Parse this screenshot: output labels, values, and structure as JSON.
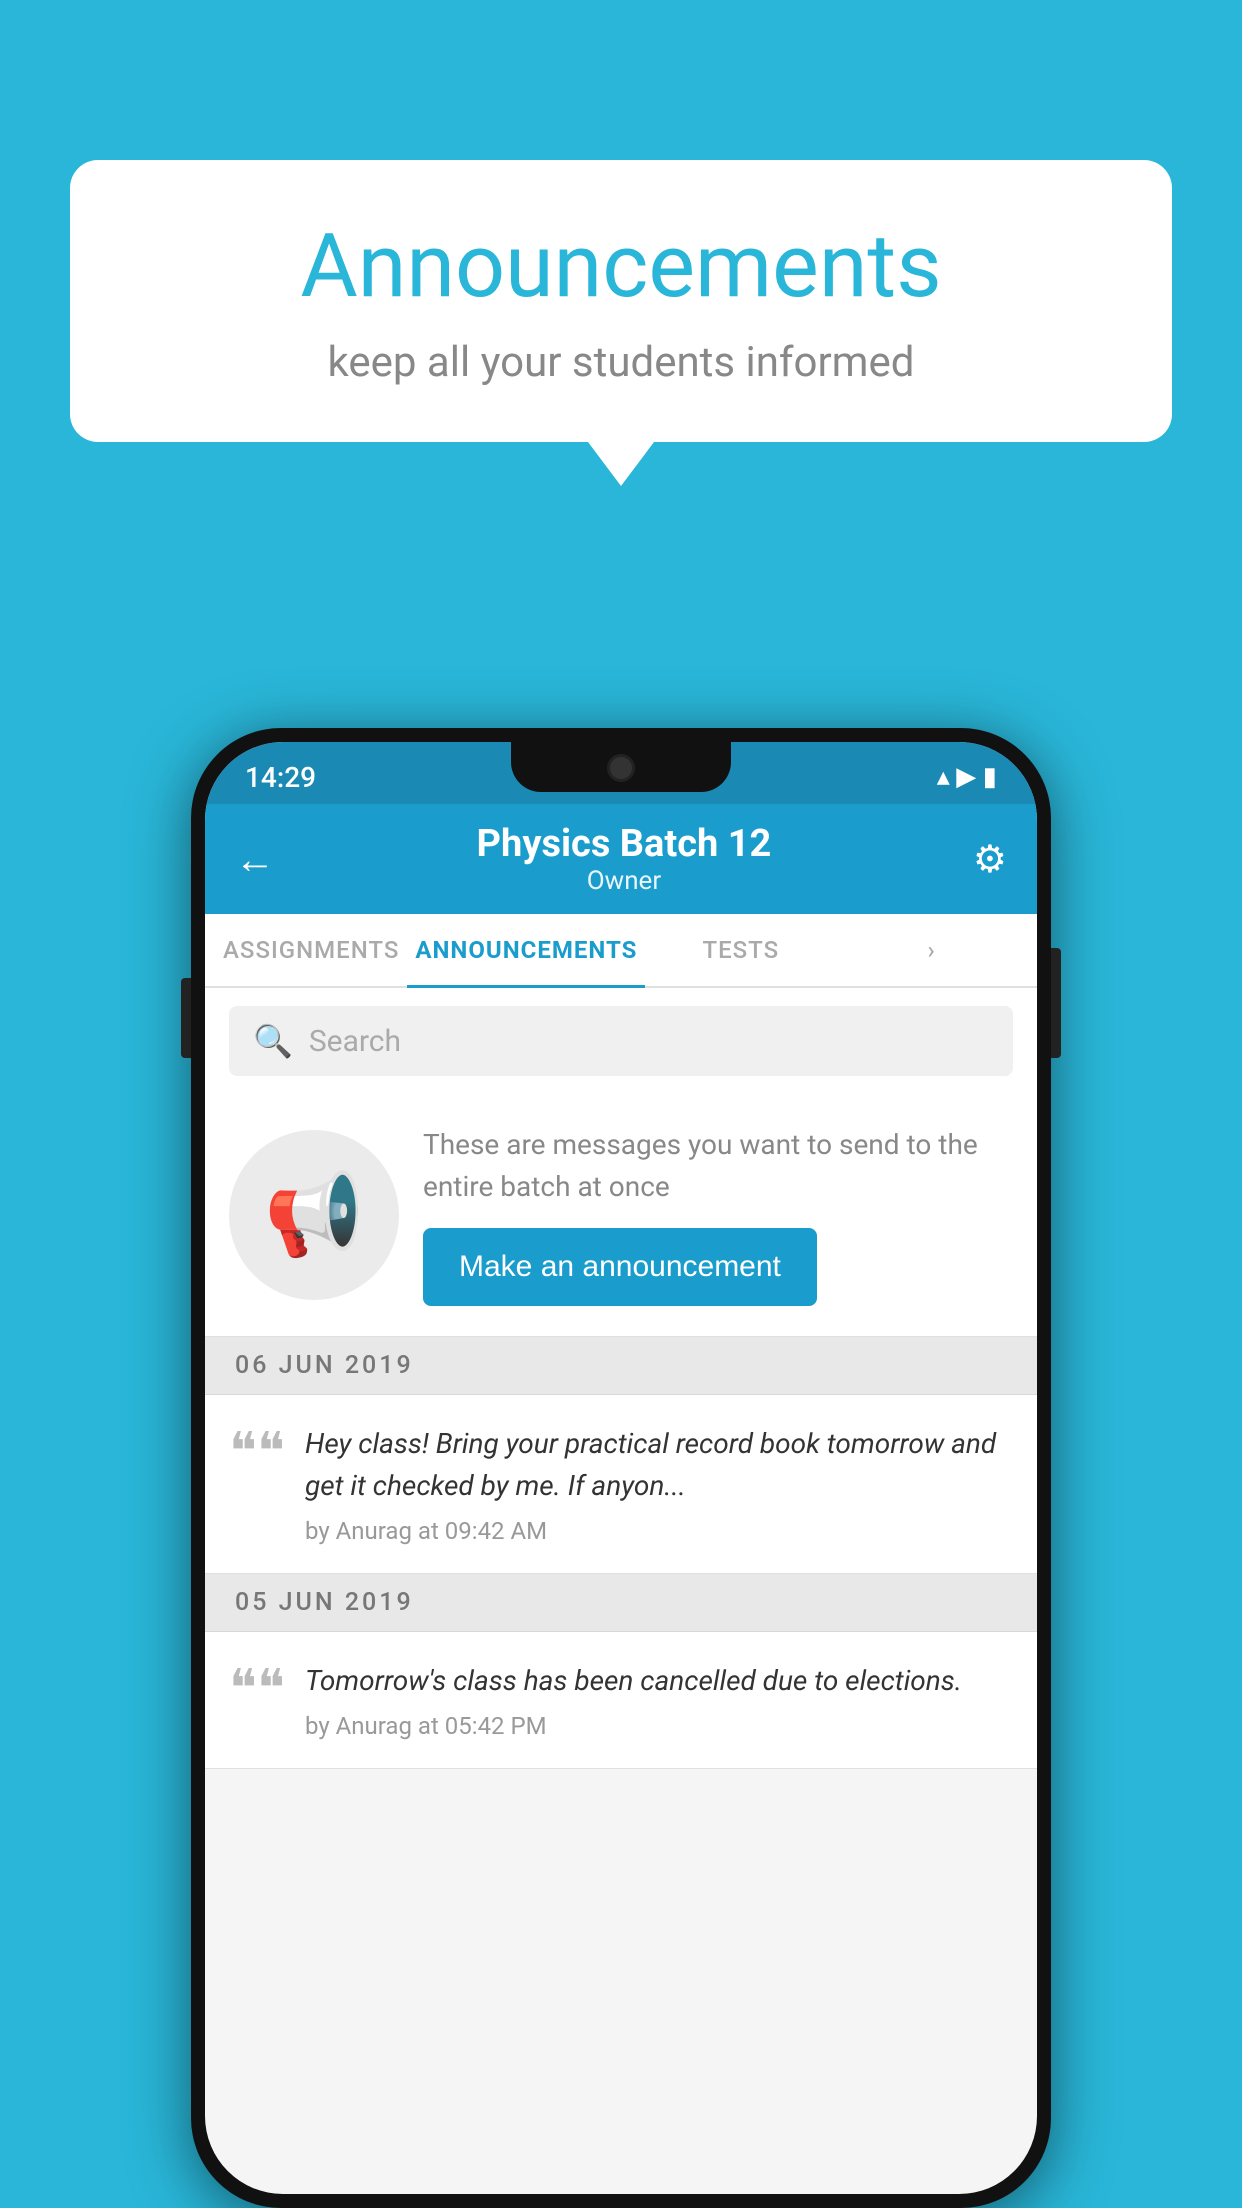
{
  "background": {
    "color": "#29b6d8"
  },
  "bubble": {
    "title": "Announcements",
    "subtitle": "keep all your students informed"
  },
  "phone": {
    "status_bar": {
      "time": "14:29",
      "wifi": "▼",
      "signal": "▲",
      "battery": "▮"
    },
    "header": {
      "title": "Physics Batch 12",
      "subtitle": "Owner",
      "back_label": "←",
      "gear_label": "⚙"
    },
    "tabs": [
      {
        "label": "ASSIGNMENTS",
        "active": false
      },
      {
        "label": "ANNOUNCEMENTS",
        "active": true
      },
      {
        "label": "TESTS",
        "active": false
      },
      {
        "label": "›",
        "active": false
      }
    ],
    "search": {
      "placeholder": "Search"
    },
    "promo": {
      "description": "These are messages you want to send to the entire batch at once",
      "button_label": "Make an announcement"
    },
    "announcements": [
      {
        "date": "06  JUN  2019",
        "text": "Hey class! Bring your practical record book tomorrow and get it checked by me. If anyon...",
        "meta": "by Anurag at 09:42 AM"
      },
      {
        "date": "05  JUN  2019",
        "text": "Tomorrow's class has been cancelled due to elections.",
        "meta": "by Anurag at 05:42 PM"
      }
    ]
  }
}
